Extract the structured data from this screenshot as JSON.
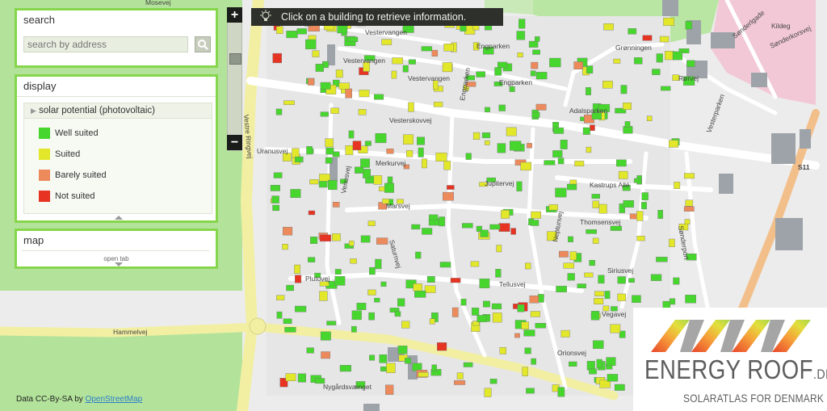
{
  "info_bar": {
    "text": "Click on a building to retrieve information.",
    "icon": "lightbulb-icon"
  },
  "search": {
    "title": "search",
    "placeholder": "search by address",
    "button_icon": "magnifier-icon"
  },
  "display": {
    "title": "display",
    "group_label": "solar potential (photovoltaic)",
    "legend": [
      {
        "label": "Well suited",
        "color": "#47d62d"
      },
      {
        "label": "Suited",
        "color": "#e2e829"
      },
      {
        "label": "Barely suited",
        "color": "#ec8a5c"
      },
      {
        "label": "Not suited",
        "color": "#e63322"
      }
    ]
  },
  "map_tab": {
    "title": "map",
    "open_label": "open tab"
  },
  "zoom": {
    "in": "+",
    "out": "−"
  },
  "attribution": {
    "prefix": "Data CC-By-SA by ",
    "link": "OpenStreetMap"
  },
  "logo": {
    "title": "ENERGY ROOF",
    "suffix": ".DK",
    "tagline": "SOLARATLAS FOR DENMARK"
  },
  "streets": [
    {
      "name": "Vestervangen"
    },
    {
      "name": "Vestervangen"
    },
    {
      "name": "Vestervangen"
    },
    {
      "name": "Engparken"
    },
    {
      "name": "Engparken"
    },
    {
      "name": "Engparken"
    },
    {
      "name": "Adalsparken"
    },
    {
      "name": "Vesterskovvej"
    },
    {
      "name": "Merkurvej"
    },
    {
      "name": "Uranusvej"
    },
    {
      "name": "Venusvej"
    },
    {
      "name": "Marsvej"
    },
    {
      "name": "Saturnvej"
    },
    {
      "name": "Plutovej"
    },
    {
      "name": "Jupitervej"
    },
    {
      "name": "Tellusvej"
    },
    {
      "name": "Neptunvej"
    },
    {
      "name": "Thomsensvej"
    },
    {
      "name": "Kastrups Allé"
    },
    {
      "name": "Siriusvej"
    },
    {
      "name": "Vegavej"
    },
    {
      "name": "Orionsvej"
    },
    {
      "name": "Hammelvej"
    },
    {
      "name": "Nygårdsvænget"
    },
    {
      "name": "Sønderkorsvej"
    },
    {
      "name": "Vesterparken"
    },
    {
      "name": "Rørvej"
    },
    {
      "name": "Grønningen"
    },
    {
      "name": "Vestre Ringvej"
    },
    {
      "name": "Sønderport"
    }
  ],
  "map_labels": [
    {
      "text": "Mosevej"
    },
    {
      "text": "Sønderlgade"
    },
    {
      "text": "S11"
    },
    {
      "text": "Kildeg"
    }
  ]
}
